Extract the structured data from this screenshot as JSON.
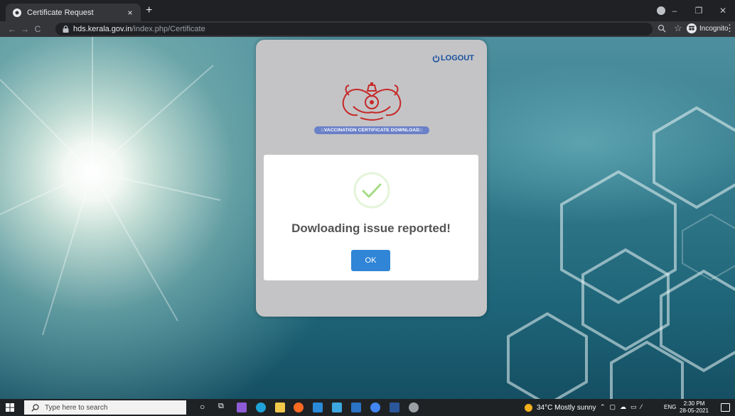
{
  "browser": {
    "tab_title": "Certificate Request",
    "tab_close": "×",
    "new_tab": "+",
    "url_host": "hds.kerala.gov.in",
    "url_path": "/index.php/Certificate",
    "profile_label": "Incognito",
    "window_controls": [
      "–",
      "❐",
      "✕"
    ]
  },
  "page": {
    "logout_label": "LOGOUT",
    "banner_text": "::VACCINATION CERTIFICATE DOWNLOAD::"
  },
  "modal": {
    "title": "Dowloading issue reported!",
    "ok_label": "OK"
  },
  "taskbar": {
    "search_placeholder": "Type here to search",
    "weather": "34°C  Mostly sunny",
    "language": "ENG",
    "time": "2:30 PM",
    "date": "28-05-2021"
  },
  "colors": {
    "logout": "#1a4fa0",
    "banner": "#6a80c8",
    "ok_button": "#3085d6",
    "success_check": "#a5dc86"
  }
}
